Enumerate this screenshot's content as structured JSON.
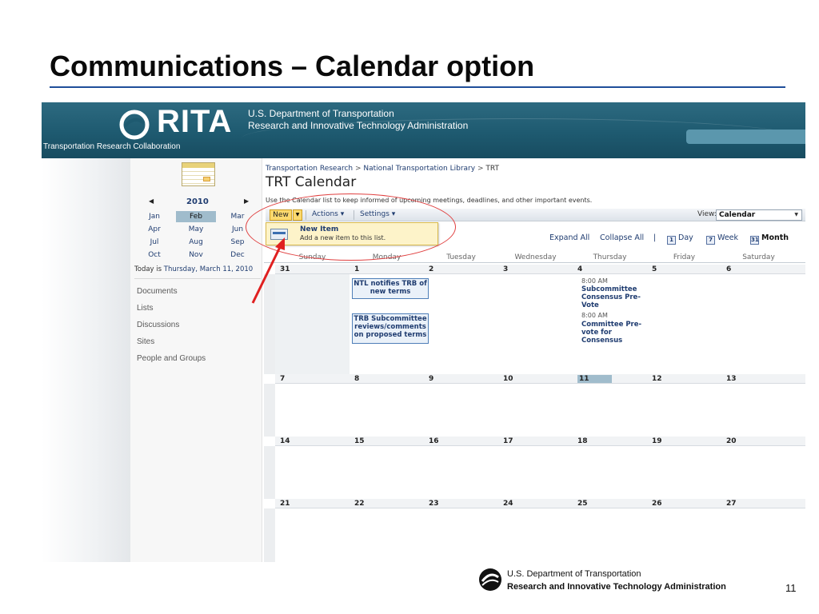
{
  "slide": {
    "title": "Communications – Calendar option",
    "page_number": "11",
    "footer_line1": "U.S. Department of Transportation",
    "footer_line2": "Research and Innovative Technology Administration"
  },
  "banner": {
    "logo_text": "RITA",
    "dept_line1": "U.S. Department of Transportation",
    "dept_line2": "Research and Innovative Technology Administration",
    "site_name": "Transportation Research Collaboration"
  },
  "leftnav": {
    "year": "2010",
    "prev_icon": "chevron-left-icon",
    "next_icon": "chevron-right-icon",
    "months": [
      "Jan",
      "Feb",
      "Mar",
      "Apr",
      "May",
      "Jun",
      "Jul",
      "Aug",
      "Sep",
      "Oct",
      "Nov",
      "Dec"
    ],
    "selected_month": "Feb",
    "today_prefix": "Today is ",
    "today_value": "Thursday, March 11, 2010",
    "links": [
      "Documents",
      "Lists",
      "Discussions",
      "Sites",
      "People and Groups"
    ]
  },
  "main": {
    "breadcrumb": [
      "Transportation Research",
      "National Transportation Library",
      "TRT"
    ],
    "breadcrumb_sep": " > ",
    "title": "TRT Calendar",
    "description": "Use the Calendar list to keep informed of upcoming meetings, deadlines, and other important events."
  },
  "toolbar": {
    "new_label": "New",
    "actions_label": "Actions ▾",
    "settings_label": "Settings ▾",
    "view_label": "View:",
    "view_value": "Calendar"
  },
  "new_menu": {
    "item_title": "New Item",
    "item_desc": "Add a new item to this list."
  },
  "viewnav": {
    "expand_all": "Expand All",
    "collapse_all": "Collapse All",
    "day_num": "1",
    "day_label": "Day",
    "week_num": "7",
    "week_label": "Week",
    "month_num": "31",
    "month_label": "Month"
  },
  "calendar": {
    "weekdays": [
      "Sunday",
      "Monday",
      "Tuesday",
      "Wednesday",
      "Thursday",
      "Friday",
      "Saturday"
    ],
    "weeks": [
      [
        "31",
        "1",
        "2",
        "3",
        "4",
        "5",
        "6"
      ],
      [
        "7",
        "8",
        "9",
        "10",
        "11",
        "12",
        "13"
      ],
      [
        "14",
        "15",
        "16",
        "17",
        "18",
        "19",
        "20"
      ],
      [
        "21",
        "22",
        "23",
        "24",
        "25",
        "26",
        "27"
      ]
    ],
    "today_date": "11",
    "events": {
      "mon1_a": "NTL notifies TRB of new terms",
      "mon1_b": "TRB Subcommittee reviews/comments on proposed terms",
      "thu4_a_time": "8:00 AM",
      "thu4_a_title": "Subcommittee Consensus Pre-Vote",
      "thu4_b_time": "8:00 AM",
      "thu4_b_title": "Committee Pre-vote for Consensus"
    }
  },
  "colors": {
    "title_rule": "#1f4e9a",
    "banner": "#1e5a70",
    "link": "#1f3c70",
    "new_button": "#fbd96e",
    "today_cell": "#a0bccc",
    "callout": "#e04040"
  }
}
